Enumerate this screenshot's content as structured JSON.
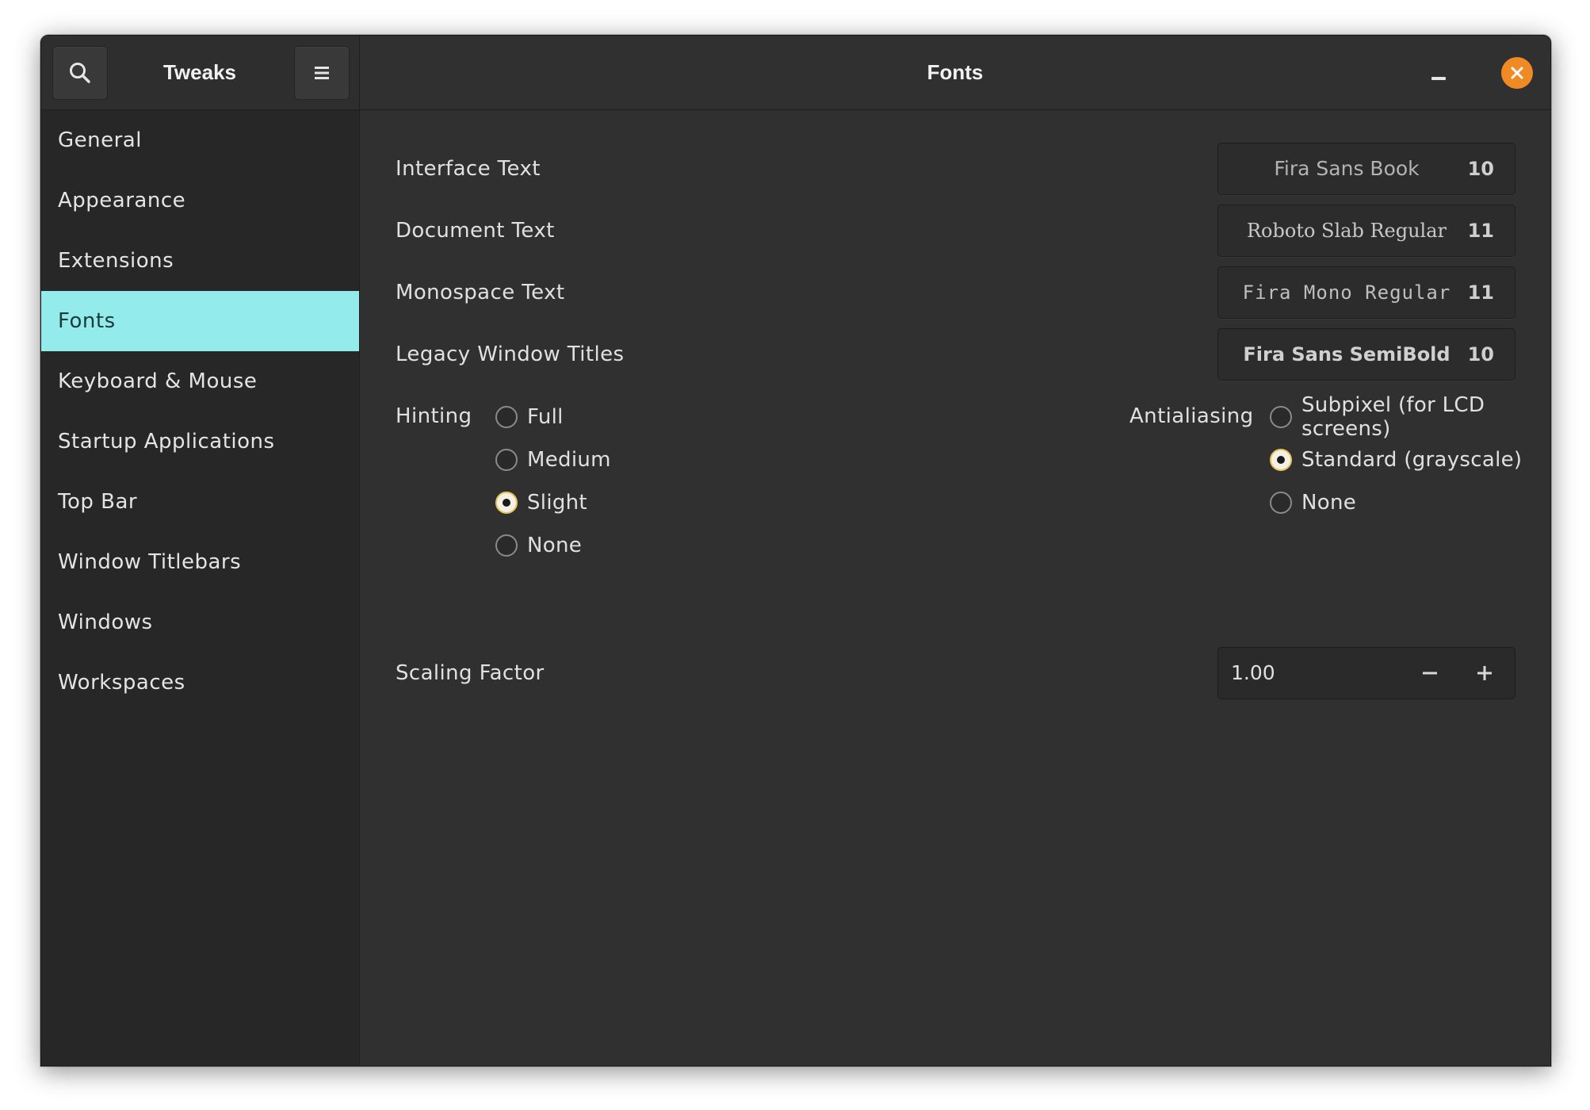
{
  "header": {
    "sidebar_title": "Tweaks",
    "page_title": "Fonts",
    "accent_close": "#f08a24"
  },
  "sidebar": {
    "items": [
      {
        "label": "General"
      },
      {
        "label": "Appearance"
      },
      {
        "label": "Extensions"
      },
      {
        "label": "Fonts"
      },
      {
        "label": "Keyboard & Mouse"
      },
      {
        "label": "Startup Applications"
      },
      {
        "label": "Top Bar"
      },
      {
        "label": "Window Titlebars"
      },
      {
        "label": "Windows"
      },
      {
        "label": "Workspaces"
      }
    ],
    "selected": "Fonts",
    "selected_color": "#94ebeb"
  },
  "fonts": {
    "interface": {
      "label": "Interface Text",
      "font": "Fira Sans Book",
      "size": "10"
    },
    "document": {
      "label": "Document Text",
      "font": "Roboto Slab Regular",
      "size": "11"
    },
    "monospace": {
      "label": "Monospace Text",
      "font": "Fira Mono Regular",
      "size": "11"
    },
    "legacy": {
      "label": "Legacy Window Titles",
      "font": "Fira Sans SemiBold",
      "size": "10"
    }
  },
  "hinting": {
    "label": "Hinting",
    "options": [
      "Full",
      "Medium",
      "Slight",
      "None"
    ],
    "selected": "Slight"
  },
  "antialiasing": {
    "label": "Antialiasing",
    "options": [
      "Subpixel (for LCD screens)",
      "Standard (grayscale)",
      "None"
    ],
    "selected": "Standard (grayscale)"
  },
  "scaling": {
    "label": "Scaling Factor",
    "value": "1.00"
  },
  "icons": {
    "search": "search-icon",
    "menu": "hamburger-menu-icon",
    "minimize": "minimize-icon",
    "close": "close-icon",
    "decrement": "minus-icon",
    "increment": "plus-icon"
  }
}
